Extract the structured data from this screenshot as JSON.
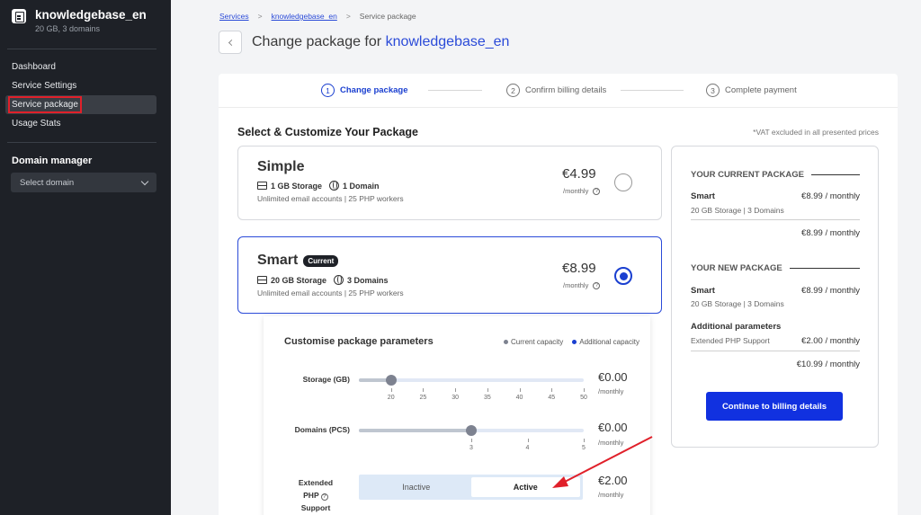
{
  "sidebar": {
    "brand_name": "knowledgebase_en",
    "brand_sub": "20 GB, 3 domains",
    "items": [
      {
        "label": "Dashboard"
      },
      {
        "label": "Service Settings"
      },
      {
        "label": "Service package"
      },
      {
        "label": "Usage Stats"
      }
    ],
    "domain_manager_title": "Domain manager",
    "domain_select_value": "Select domain"
  },
  "breadcrumb": {
    "services": "Services",
    "service": "knowledgebase_en",
    "current": "Service package",
    "separator": ">"
  },
  "header": {
    "title_prefix": "Change package for",
    "service_name": "knowledgebase_en"
  },
  "steps": [
    {
      "num": "1",
      "label": "Change package"
    },
    {
      "num": "2",
      "label": "Confirm billing details"
    },
    {
      "num": "3",
      "label": "Complete payment"
    }
  ],
  "main": {
    "section_title": "Select & Customize Your Package",
    "vat_note": "*VAT excluded in all presented prices"
  },
  "packages": [
    {
      "name": "Simple",
      "storage": "1 GB Storage",
      "domains": "1 Domain",
      "sub": "Unlimited email accounts  |  25 PHP workers",
      "price": "€4.99",
      "per": "/monthly",
      "selected": false
    },
    {
      "name": "Smart",
      "badge": "Current",
      "storage": "20 GB Storage",
      "domains": "3 Domains",
      "sub": "Unlimited email accounts  |  25 PHP workers",
      "price": "€8.99",
      "per": "/monthly",
      "selected": true
    }
  ],
  "customise": {
    "title": "Customise package parameters",
    "legend_current": "Current capacity",
    "legend_additional": "Additional capacity",
    "storage": {
      "label": "Storage (GB)",
      "ticks": [
        "20",
        "25",
        "30",
        "35",
        "40",
        "45",
        "50"
      ],
      "value": 20,
      "min": 15,
      "max": 50,
      "price": "€0.00",
      "per": "/monthly"
    },
    "domains": {
      "label": "Domains (PCS)",
      "ticks": [
        "3",
        "4",
        "5"
      ],
      "value": 3,
      "min": 1,
      "max": 5,
      "price": "€0.00",
      "per": "/monthly"
    },
    "php": {
      "label_line1": "Extended",
      "label_line2": "PHP",
      "label_line3": "Support",
      "options": [
        "Inactive",
        "Active"
      ],
      "selected": "Active",
      "price": "€2.00",
      "per": "/monthly"
    }
  },
  "summary": {
    "current_title": "YOUR CURRENT PACKAGE",
    "current_name": "Smart",
    "current_price": "€8.99 / monthly",
    "current_details": "20 GB Storage  |  3 Domains",
    "current_total": "€8.99 / monthly",
    "new_title": "YOUR NEW PACKAGE",
    "new_name": "Smart",
    "new_price": "€8.99 / monthly",
    "new_details": "20 GB Storage   |   3 Domains",
    "additional_title": "Additional parameters",
    "additional_item": "Extended PHP Support",
    "additional_price": "€2.00 / monthly",
    "new_total": "€10.99 / monthly",
    "cta_label": "Continue to billing details"
  },
  "colors": {
    "accent": "#1a3fd0",
    "cta": "#1131e0",
    "sidebar_bg": "#1e2127",
    "highlight_box": "#e0202a",
    "arrow": "#e0202a",
    "legend_current": "#7d8290",
    "legend_additional": "#1a3fd0"
  }
}
